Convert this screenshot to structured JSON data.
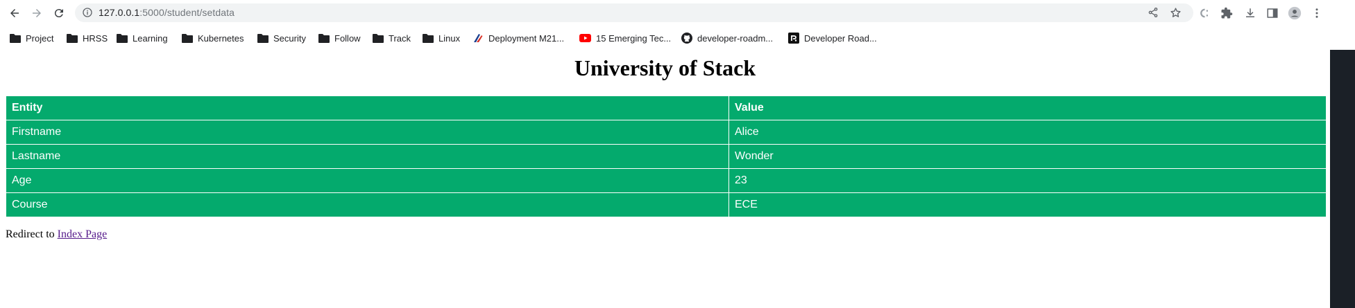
{
  "browser": {
    "url_host": "127.0.0.1",
    "url_path": ":5000/student/setdata",
    "bookmarks": [
      {
        "label": "Project",
        "icon": "folder-icon"
      },
      {
        "label": "HRSS",
        "icon": "folder-icon"
      },
      {
        "label": "Learning",
        "icon": "folder-icon"
      },
      {
        "label": "Kubernetes",
        "icon": "folder-icon"
      },
      {
        "label": "Security",
        "icon": "folder-icon"
      },
      {
        "label": "Follow",
        "icon": "folder-icon"
      },
      {
        "label": "Track",
        "icon": "folder-icon"
      },
      {
        "label": "Linux",
        "icon": "folder-icon"
      },
      {
        "label": "Deployment M21...",
        "icon": "deployment-logo-icon"
      },
      {
        "label": "15 Emerging Tec...",
        "icon": "youtube-icon"
      },
      {
        "label": "developer-roadm...",
        "icon": "github-icon"
      },
      {
        "label": "Developer Road...",
        "icon": "roadmap-logo-icon"
      }
    ]
  },
  "page": {
    "title": "University of Stack",
    "table": {
      "headers": [
        "Entity",
        "Value"
      ],
      "rows": [
        [
          "Firstname",
          "Alice"
        ],
        [
          "Lastname",
          "Wonder"
        ],
        [
          "Age",
          "23"
        ],
        [
          "Course",
          "ECE"
        ]
      ]
    },
    "redirect_text": "Redirect to ",
    "redirect_link": "Index Page"
  },
  "colors": {
    "table_green": "#04aa6d",
    "link_visited": "#551a8b"
  }
}
